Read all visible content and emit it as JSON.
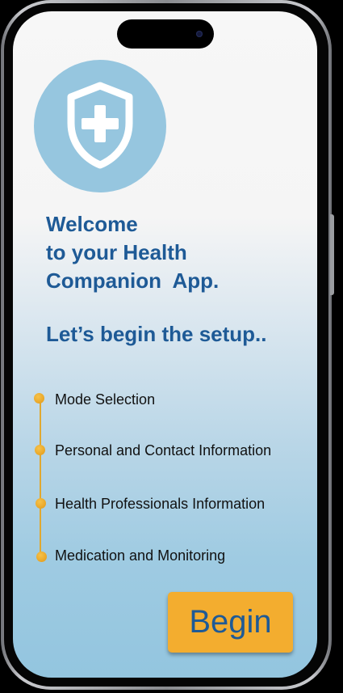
{
  "app": {
    "logo_icon": "shield-plus-icon",
    "welcome_lines": [
      "Welcome",
      "to your Health",
      "Companion  App."
    ],
    "setup_heading": "Let’s begin the setup.."
  },
  "steps": [
    {
      "label": "Mode Selection"
    },
    {
      "label": "Personal and Contact Information"
    },
    {
      "label": "Health Professionals Information"
    },
    {
      "label": "Medication and Monitoring"
    }
  ],
  "actions": {
    "begin_label": "Begin"
  },
  "colors": {
    "heading": "#1e5a96",
    "accent": "#f3ad2f",
    "logo_circle": "#96c6df",
    "timeline": "#e0a830"
  }
}
